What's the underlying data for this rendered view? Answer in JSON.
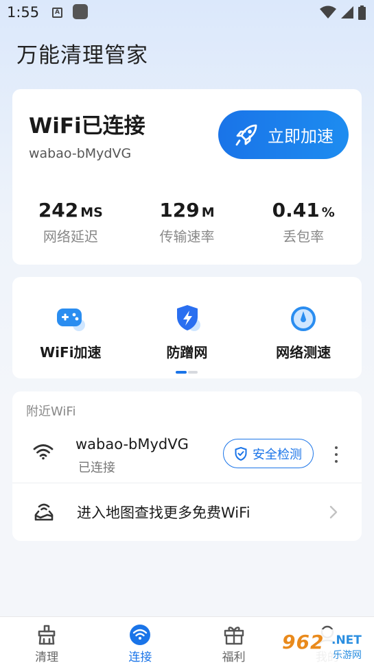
{
  "status_bar": {
    "time": "1:55",
    "notif_letter": "A"
  },
  "app": {
    "title": "万能清理管家"
  },
  "connection": {
    "status": "WiFi已连接",
    "ssid": "wabao-bMydVG",
    "boost_label": "立即加速",
    "stats": [
      {
        "value": "242",
        "unit": "MS",
        "label": "网络延迟"
      },
      {
        "value": "129",
        "unit": "M",
        "label": "传输速率"
      },
      {
        "value": "0.41",
        "unit": "%",
        "label": "丢包率"
      }
    ]
  },
  "tools": [
    {
      "label": "WiFi加速",
      "icon": "gamepad-icon"
    },
    {
      "label": "防蹭网",
      "icon": "shield-bolt-icon"
    },
    {
      "label": "网络测速",
      "icon": "speedometer-icon"
    }
  ],
  "nearby": {
    "title": "附近WiFi",
    "network": {
      "ssid": "wabao-bMydVG",
      "state": "已连接",
      "security_label": "安全检测"
    },
    "map_link": "进入地图查找更多免费WiFi"
  },
  "bottom_nav": [
    {
      "label": "清理",
      "icon": "broom-icon",
      "active": false
    },
    {
      "label": "连接",
      "icon": "wifi-icon",
      "active": true
    },
    {
      "label": "福利",
      "icon": "gift-icon",
      "active": false
    },
    {
      "label": "我的",
      "icon": "profile-icon",
      "active": false
    }
  ],
  "watermark": {
    "main": "962",
    "net": ".NET",
    "sub": "乐游网"
  },
  "colors": {
    "accent": "#1a74e8",
    "accent_light": "#1d8cf0",
    "text": "#1a1a1a",
    "muted": "#888888"
  }
}
